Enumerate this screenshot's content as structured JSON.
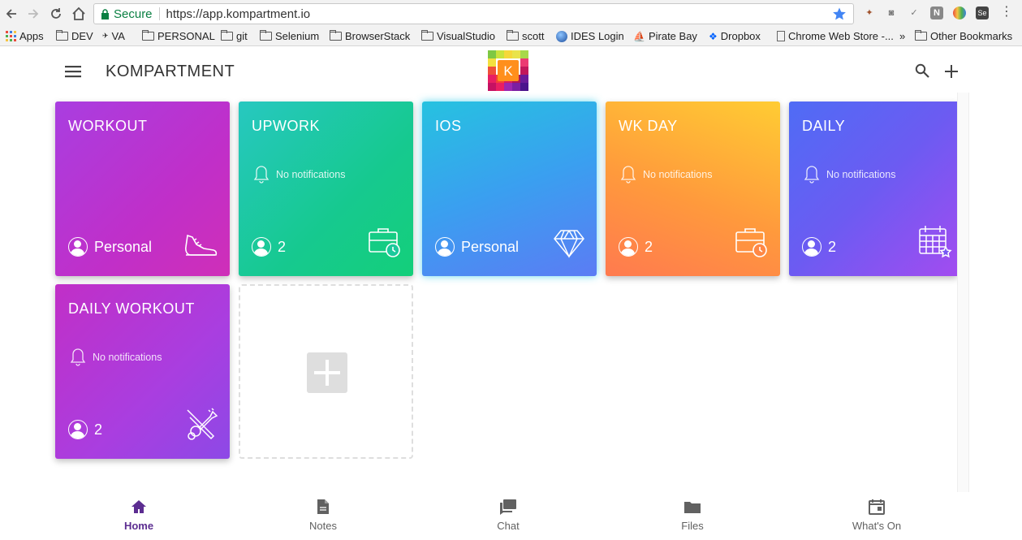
{
  "browser": {
    "secure_label": "Secure",
    "url": "https://app.kompartment.io",
    "bookmarks": [
      {
        "label": "Apps",
        "icon": "apps-grid-icon"
      },
      {
        "label": "DEV",
        "icon": "folder-icon"
      },
      {
        "label": "VA",
        "icon": "va-icon"
      },
      {
        "label": "PERSONAL",
        "icon": "folder-icon"
      },
      {
        "label": "git",
        "icon": "folder-icon"
      },
      {
        "label": "Selenium",
        "icon": "folder-icon"
      },
      {
        "label": "BrowserStack",
        "icon": "folder-icon"
      },
      {
        "label": "VisualStudio",
        "icon": "folder-icon"
      },
      {
        "label": "scott",
        "icon": "folder-icon"
      },
      {
        "label": "IDES Login",
        "icon": "globe-icon"
      },
      {
        "label": "Pirate Bay",
        "icon": "ship-icon"
      },
      {
        "label": "Dropbox",
        "icon": "dropbox-icon"
      },
      {
        "label": "Chrome Web Store -...",
        "icon": "page-icon"
      }
    ],
    "overflow": "»",
    "other_bookmarks": "Other Bookmarks"
  },
  "header": {
    "brand": "KOMPARTMENT",
    "logo_letter": "K"
  },
  "tiles": [
    {
      "title": "WORKOUT",
      "notification": "",
      "member": "Personal",
      "icon": "running-shoe-icon"
    },
    {
      "title": "UPWORK",
      "notification": "No notifications",
      "member": "2",
      "icon": "briefcase-clock-icon"
    },
    {
      "title": "IOS",
      "notification": "",
      "member": "Personal",
      "icon": "diamond-icon"
    },
    {
      "title": "WK DAY",
      "notification": "No notifications",
      "member": "2",
      "icon": "briefcase-clock-icon"
    },
    {
      "title": "DAILY",
      "notification": "No notifications",
      "member": "2",
      "icon": "calendar-star-icon"
    },
    {
      "title": "DAILY WORKOUT",
      "notification": "No notifications",
      "member": "2",
      "icon": "tools-crossed-icon"
    }
  ],
  "colors": {
    "workout": "#b832d6",
    "upwork": "#1cc9a8",
    "ios": "#2fa6e8",
    "wkday": "#ff9a3c",
    "daily": "#6c5bf2",
    "active_nav": "#5c2d91"
  },
  "bottom_nav": [
    {
      "label": "Home",
      "icon": "home-icon",
      "active": true
    },
    {
      "label": "Notes",
      "icon": "notes-icon",
      "active": false
    },
    {
      "label": "Chat",
      "icon": "chat-icon",
      "active": false
    },
    {
      "label": "Files",
      "icon": "folder-icon",
      "active": false
    },
    {
      "label": "What's On",
      "icon": "calendar-icon",
      "active": false
    }
  ]
}
